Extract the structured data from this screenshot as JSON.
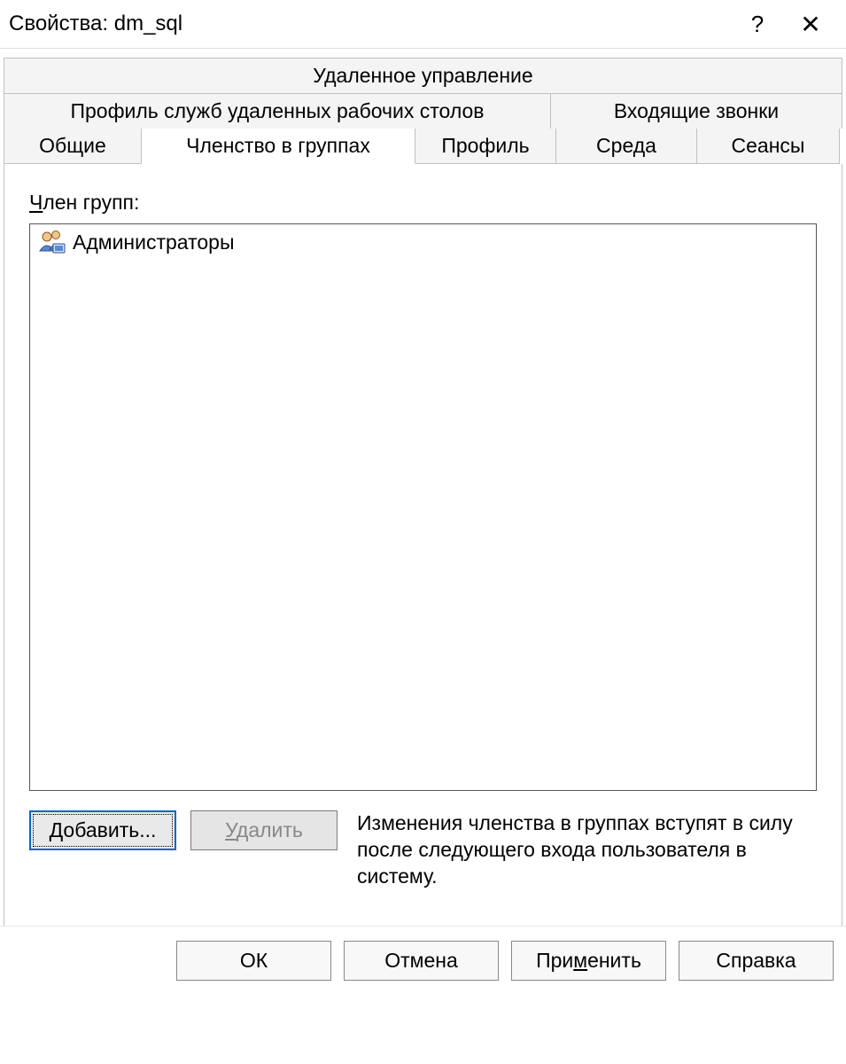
{
  "titlebar": {
    "title": "Свойства: dm_sql",
    "help": "?",
    "close": "✕"
  },
  "tabs": {
    "row1": {
      "remote_mgmt": "Удаленное управление"
    },
    "row2": {
      "rds_profile": "Профиль служб удаленных рабочих столов",
      "incoming_calls": "Входящие звонки"
    },
    "row3": {
      "general": "Общие",
      "membership": "Членство в группах",
      "profile": "Профиль",
      "environment": "Среда",
      "sessions": "Сеансы"
    }
  },
  "panel": {
    "member_of_label_pre": "Ч",
    "member_of_label_rest": "лен групп:",
    "groups": [
      {
        "name": "Администраторы"
      }
    ],
    "add_button_pre": "Д",
    "add_button_rest": "обавить...",
    "remove_button_pre": "У",
    "remove_button_rest": "далить",
    "hint": "Изменения членства в группах вступят в силу после следующего входа пользователя в систему."
  },
  "footer": {
    "ok": "ОК",
    "cancel": "Отмена",
    "apply_pre": "При",
    "apply_u": "м",
    "apply_rest": "енить",
    "help": "Справка"
  }
}
